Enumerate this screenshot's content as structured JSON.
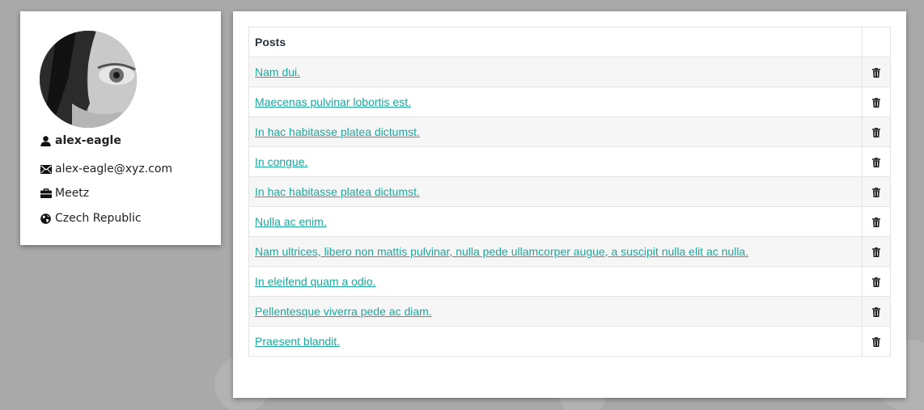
{
  "profile": {
    "username": "alex-eagle",
    "email": "alex-eagle@xyz.com",
    "company": "Meetz",
    "country": "Czech Republic",
    "icons": {
      "user": "user-icon",
      "email": "envelope-icon",
      "company": "briefcase-icon",
      "country": "globe-icon"
    }
  },
  "posts": {
    "header": "Posts",
    "items": [
      {
        "title": "Nam dui."
      },
      {
        "title": "Maecenas pulvinar lobortis est."
      },
      {
        "title": "In hac habitasse platea dictumst."
      },
      {
        "title": "In congue."
      },
      {
        "title": "In hac habitasse platea dictumst."
      },
      {
        "title": "Nulla ac enim."
      },
      {
        "title": "Nam ultrices, libero non mattis pulvinar, nulla pede ullamcorper augue, a suscipit nulla elit ac nulla."
      },
      {
        "title": "In eleifend quam a odio."
      },
      {
        "title": "Pellentesque viverra pede ac diam."
      },
      {
        "title": "Praesent blandit."
      }
    ],
    "delete_icon": "trash-icon"
  },
  "colors": {
    "link": "#1ba79d",
    "background": "#a9a9a9",
    "header_text": "#2a3340"
  }
}
